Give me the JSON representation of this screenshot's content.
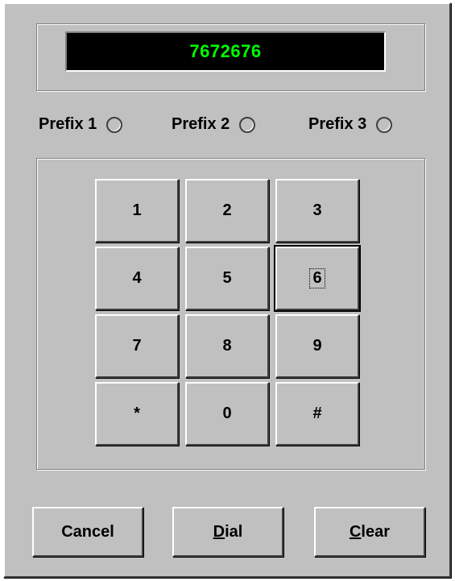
{
  "display": {
    "number": "7672676"
  },
  "prefixes": [
    {
      "label": "Prefix 1",
      "selected": false
    },
    {
      "label": "Prefix 2",
      "selected": false
    },
    {
      "label": "Prefix 3",
      "selected": false
    }
  ],
  "keypad": {
    "keys": [
      "1",
      "2",
      "3",
      "4",
      "5",
      "6",
      "7",
      "8",
      "9",
      "*",
      "0",
      "#"
    ],
    "focused_key": "6"
  },
  "buttons": {
    "cancel": "Cancel",
    "dial": {
      "mnemonic": "D",
      "rest": "ial"
    },
    "clear": {
      "mnemonic": "C",
      "rest": "lear"
    }
  },
  "colors": {
    "face": "#c0c0c0",
    "display_bg": "#000000",
    "display_text": "#00ff00"
  }
}
